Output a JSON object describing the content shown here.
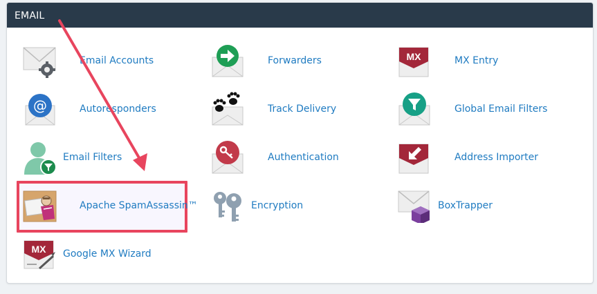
{
  "section": {
    "title": "EMAIL"
  },
  "items": [
    {
      "label": "Email Accounts",
      "icon": "envelope-gear-icon"
    },
    {
      "label": "Forwarders",
      "icon": "envelope-arrow-icon"
    },
    {
      "label": "MX Entry",
      "icon": "mx-envelope-icon"
    },
    {
      "label": "Autoresponders",
      "icon": "envelope-at-icon"
    },
    {
      "label": "Track Delivery",
      "icon": "paw-prints-icon"
    },
    {
      "label": "Global Email Filters",
      "icon": "envelope-filter-icon"
    },
    {
      "label": "Email Filters",
      "icon": "user-filter-icon"
    },
    {
      "label": "Authentication",
      "icon": "envelope-key-icon"
    },
    {
      "label": "Address Importer",
      "icon": "envelope-import-icon"
    },
    {
      "label": "Apache SpamAssassin™",
      "icon": "spamassassin-icon"
    },
    {
      "label": "Encryption",
      "icon": "keys-icon"
    },
    {
      "label": "BoxTrapper",
      "icon": "envelope-box-icon"
    },
    {
      "label": "Google MX Wizard",
      "icon": "mx-wizard-icon"
    }
  ],
  "colors": {
    "header": "#293a4a",
    "link": "#1f7bc1",
    "highlight": "#e8455e"
  }
}
